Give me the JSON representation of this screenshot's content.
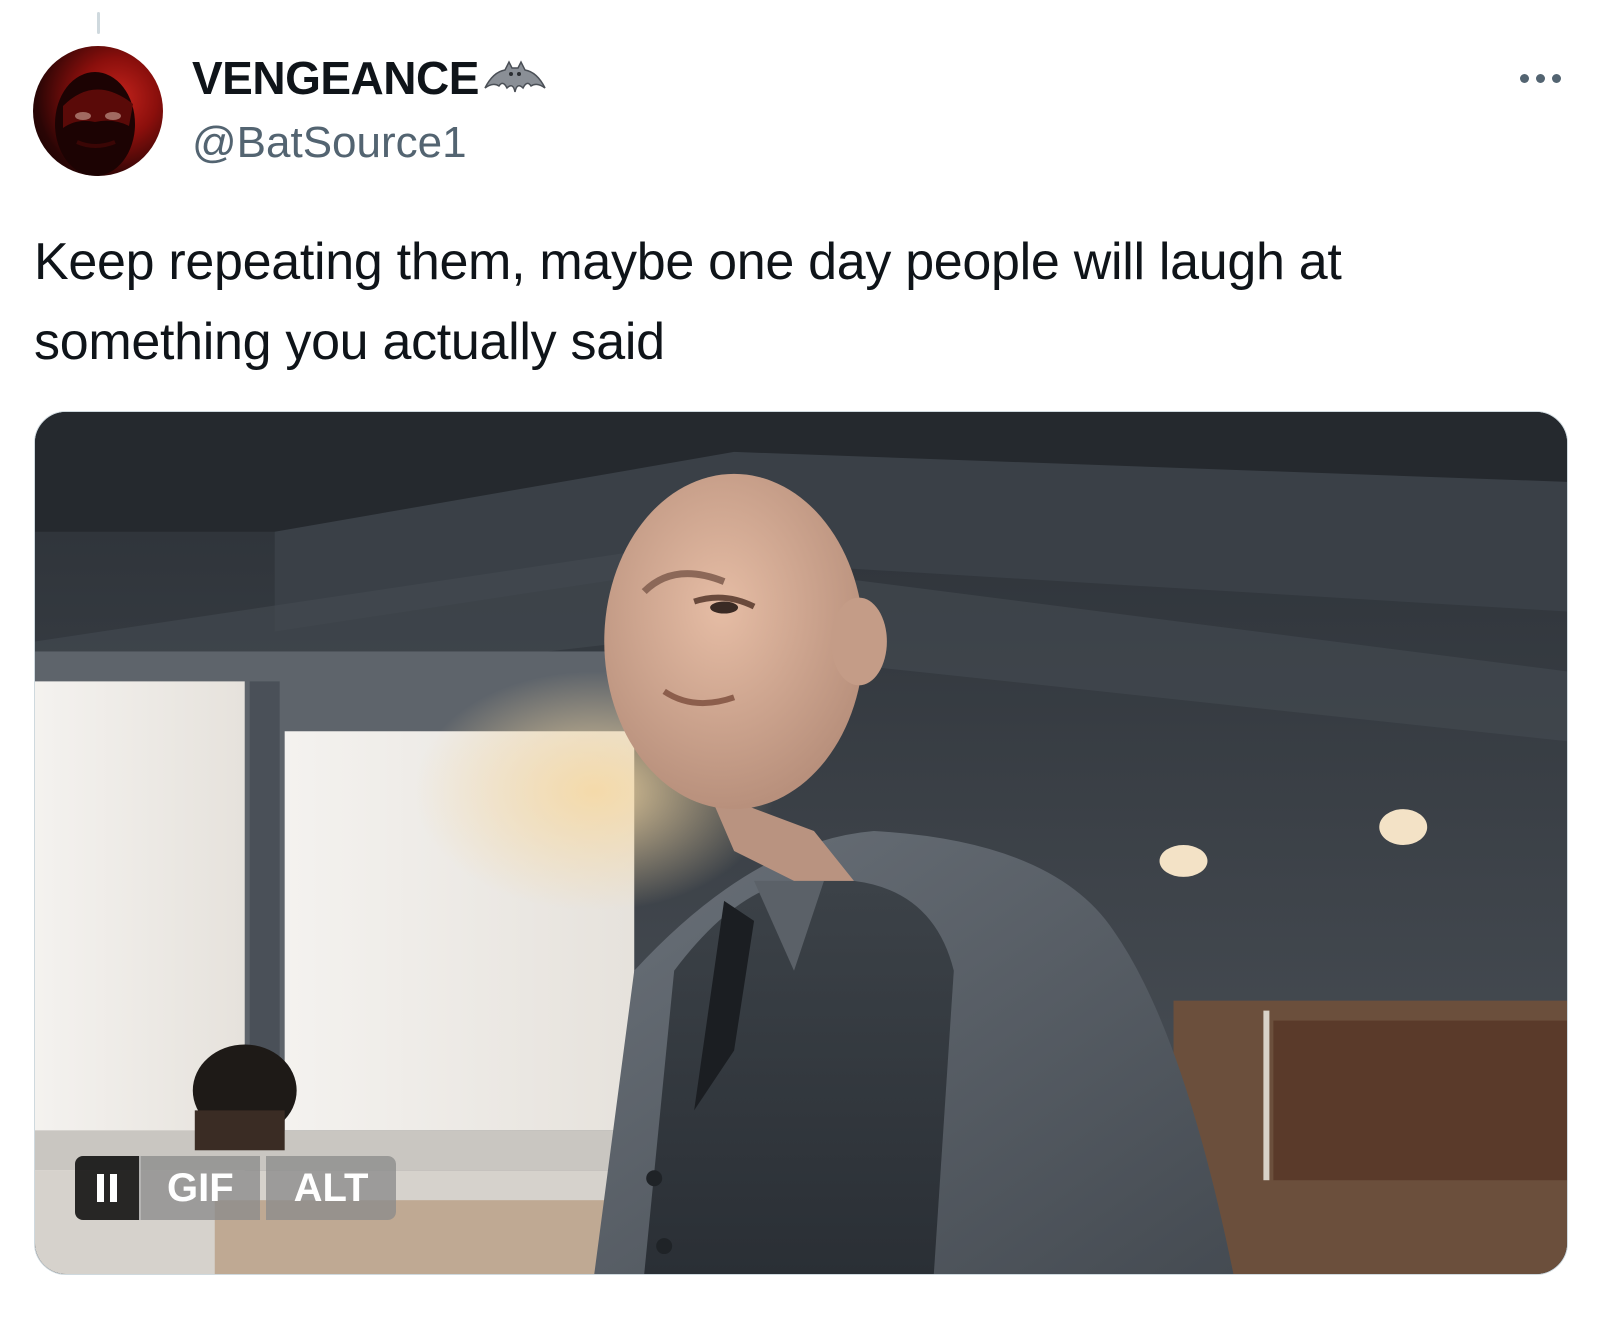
{
  "author": {
    "display_name": "VENGEANCE",
    "handle": "@BatSource1",
    "avatar_icon": "masked-hero-avatar",
    "name_badge_icon": "bat-icon"
  },
  "tweet": {
    "text": "Keep repeating them, maybe one day people will laugh at something you actually said"
  },
  "media": {
    "type": "gif",
    "gif_label": "GIF",
    "alt_label": "ALT",
    "pause_icon": "pause-icon"
  },
  "actions": {
    "more_icon": "more-dots-icon"
  },
  "colors": {
    "text_primary": "#0f1419",
    "text_secondary": "#536471",
    "border": "#cfd9de"
  }
}
